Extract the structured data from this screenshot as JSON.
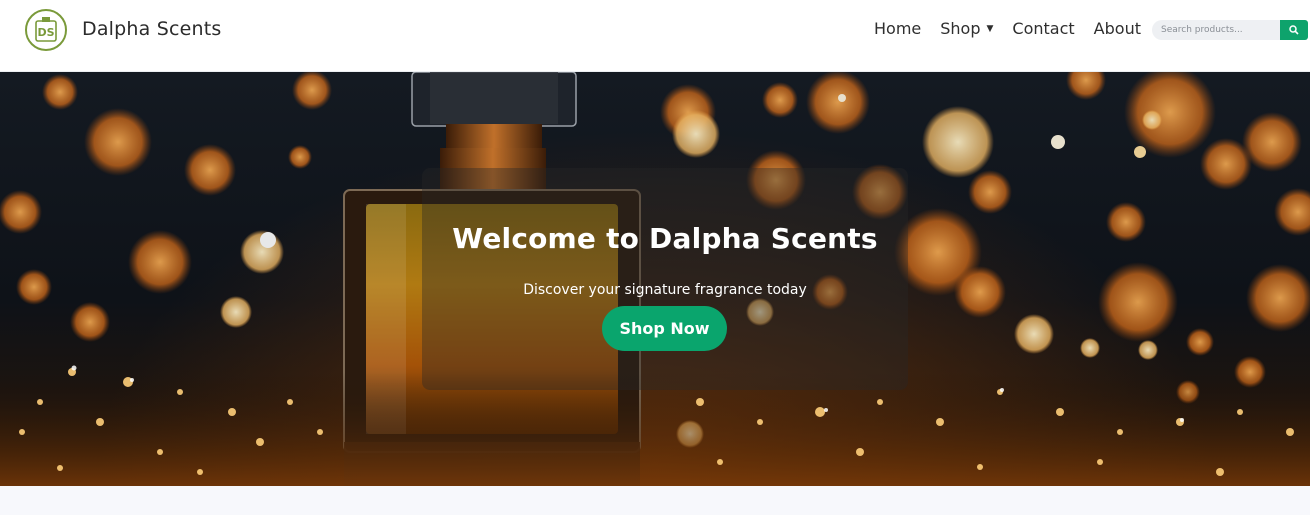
{
  "header": {
    "logo_text": "DS",
    "brand": "Dalpha Scents",
    "nav": [
      "Home",
      "Shop",
      "Contact",
      "About"
    ],
    "shop_caret": "▼",
    "search_placeholder": "Search products...",
    "accent": "#0ea36c"
  },
  "hero": {
    "title": "Welcome to Dalpha Scents",
    "subtitle": "Discover your signature fragrance today",
    "cta": "Shop Now"
  },
  "colors": {
    "brand_green": "#0aa56d",
    "logo_olive": "#7a9a3a",
    "header_bg": "#ffffff",
    "page_bg": "#f7f8fc"
  }
}
